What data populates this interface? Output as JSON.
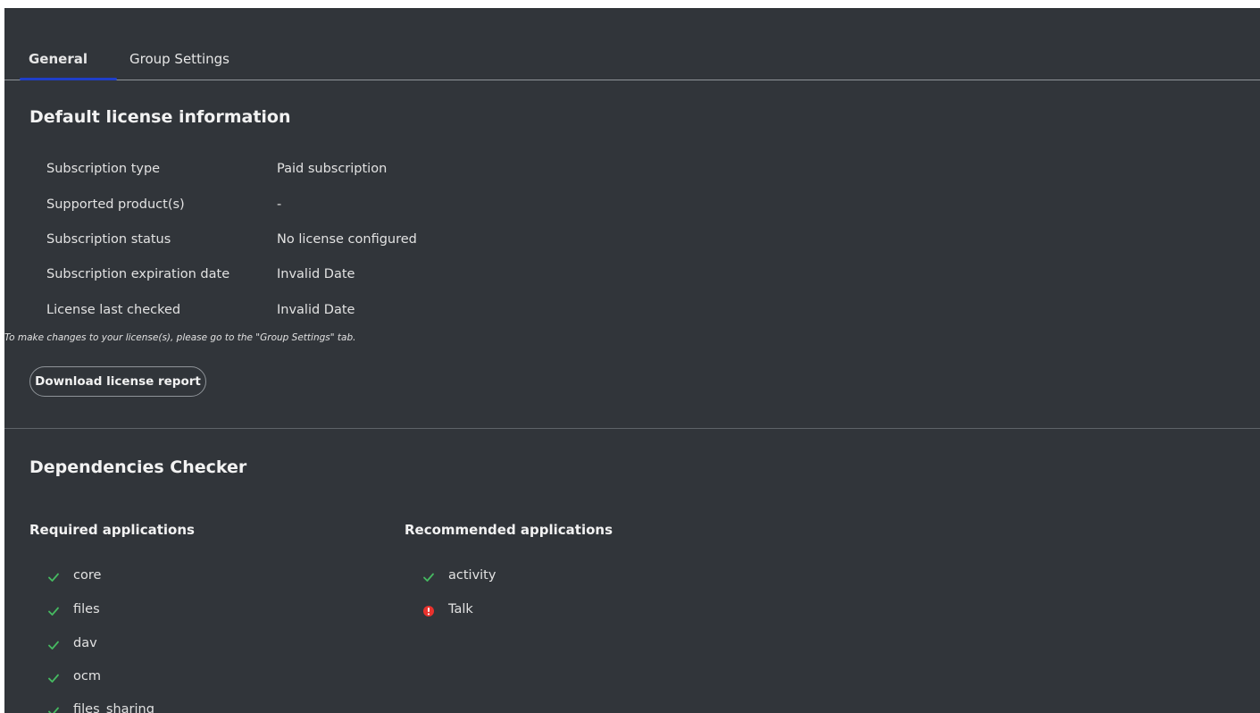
{
  "colors": {
    "background": "#31353a",
    "tab_indicator": "#1f3ec9",
    "success": "#46ba61",
    "error": "#e9322d"
  },
  "tabs": [
    {
      "label": "General",
      "active": true
    },
    {
      "label": "Group Settings",
      "active": false
    }
  ],
  "license": {
    "title": "Default license information",
    "rows": [
      {
        "label": "Subscription type",
        "value": "Paid subscription"
      },
      {
        "label": "Supported product(s)",
        "value": "-"
      },
      {
        "label": "Subscription status",
        "value": "No license configured"
      },
      {
        "label": "Subscription expiration date",
        "value": "Invalid Date"
      },
      {
        "label": "License last checked",
        "value": "Invalid Date"
      }
    ],
    "hint": "To make changes to your license(s), please go to the \"Group Settings\" tab.",
    "download_button": "Download license report"
  },
  "dependencies": {
    "title": "Dependencies Checker",
    "required_title": "Required applications",
    "recommended_title": "Recommended applications",
    "required": [
      {
        "name": "core",
        "status": "ok",
        "icon": "check-icon"
      },
      {
        "name": "files",
        "status": "ok",
        "icon": "check-icon"
      },
      {
        "name": "dav",
        "status": "ok",
        "icon": "check-icon"
      },
      {
        "name": "ocm",
        "status": "ok",
        "icon": "check-icon"
      },
      {
        "name": "files_sharing",
        "status": "ok",
        "icon": "check-icon"
      }
    ],
    "recommended": [
      {
        "name": "activity",
        "status": "ok",
        "icon": "check-icon"
      },
      {
        "name": "Talk",
        "status": "error",
        "icon": "alert-icon"
      }
    ]
  }
}
